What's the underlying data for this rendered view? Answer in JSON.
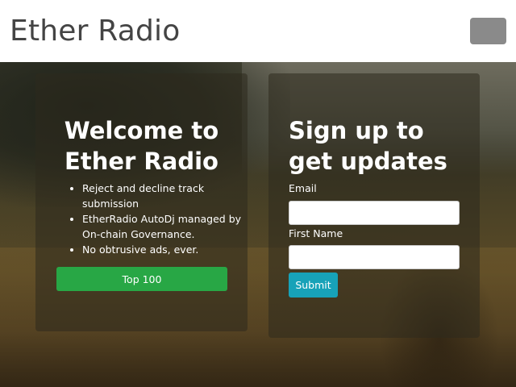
{
  "navbar": {
    "brand": "Ether Radio",
    "toggler_icon": "hamburger-menu-icon"
  },
  "welcome": {
    "title": "Welcome to Ether Radio",
    "features": [
      "Reject and decline track submission",
      "EtherRadio AutoDj managed by On-chain Governance.",
      "No obtrusive ads, ever."
    ],
    "button_label": "Top 100"
  },
  "signup": {
    "title": "Sign up to get updates",
    "email_label": "Email",
    "email_value": "",
    "first_name_label": "First Name",
    "first_name_value": "",
    "submit_label": "Submit"
  },
  "colors": {
    "success_green": "#28a745",
    "info_teal": "#17a2b8",
    "navbar_bg": "#ffffff",
    "toggler_gray": "#8a8a8a"
  }
}
